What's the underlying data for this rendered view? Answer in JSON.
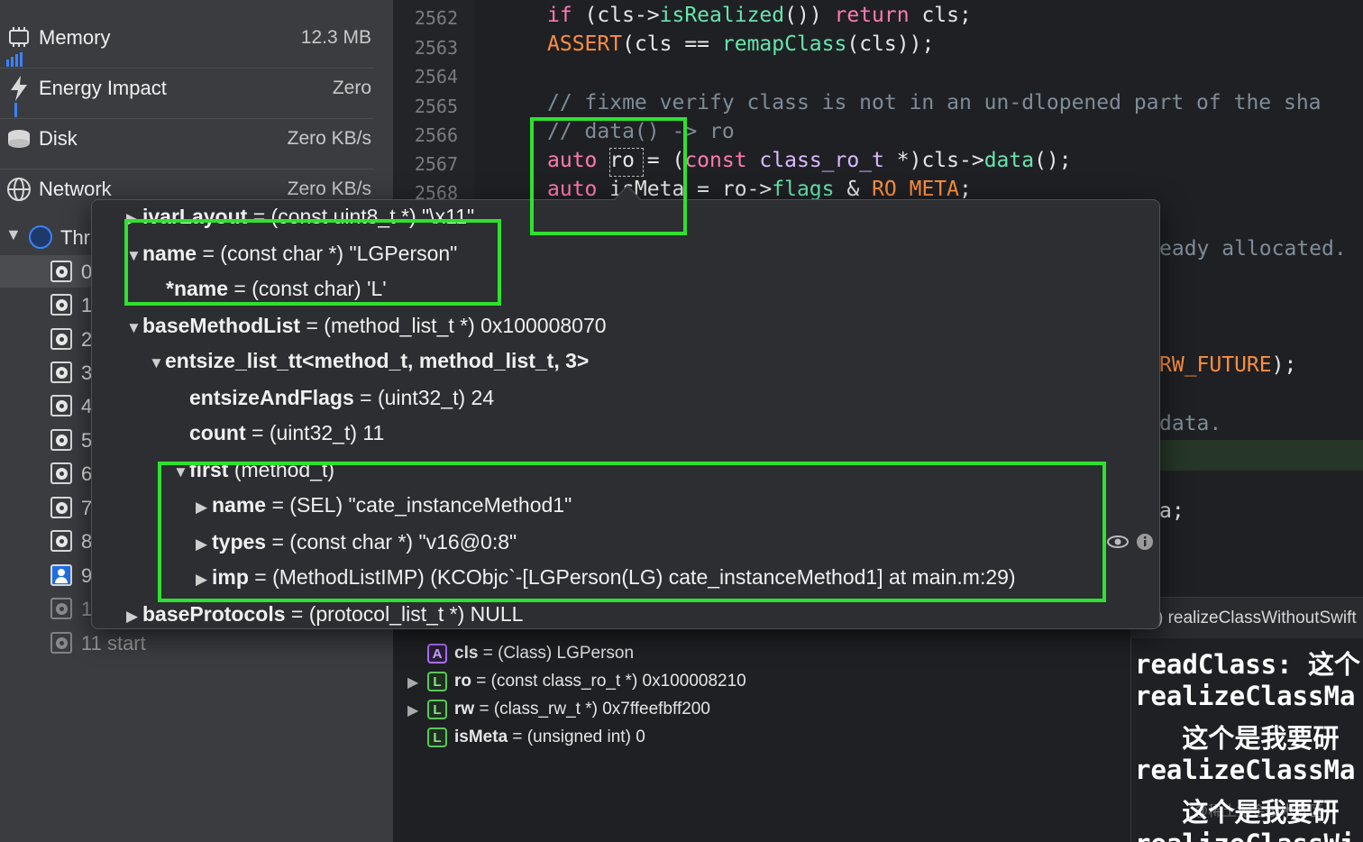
{
  "gauges": [
    {
      "name": "Memory",
      "value": "12.3 MB",
      "icon": "memory-chip-icon"
    },
    {
      "name": "Energy Impact",
      "value": "Zero",
      "icon": "bolt-icon"
    },
    {
      "name": "Disk",
      "value": "Zero KB/s",
      "icon": "disk-icon"
    },
    {
      "name": "Network",
      "value": "Zero KB/s",
      "icon": "globe-icon"
    }
  ],
  "threads": {
    "header": "Thr",
    "items": [
      "0",
      "1",
      "2",
      "3",
      "4",
      "5",
      "6",
      "7",
      "8",
      "9",
      "1"
    ],
    "last": "11 start"
  },
  "editor": {
    "line_numbers": [
      "2562",
      "2563",
      "2564",
      "2565",
      "2566",
      "2567",
      "2568"
    ],
    "fragments": {
      "l1_kw": "if",
      "l1_a": " (cls->",
      "l1_fn": "isRealized",
      "l1_b": "()) ",
      "l1_kw2": "return",
      "l1_c": " cls;",
      "l2_macro": "ASSERT",
      "l2_a": "(cls == ",
      "l2_fn": "remapClass",
      "l2_b": "(cls));",
      "l4_cm": "// fixme verify class is not in an un-dlopened part of the sha",
      "l5_cm": "// data() -> ro",
      "l6_kw": "auto",
      "l6_a": " ro = (",
      "l6_kw2": "const",
      "l6_ty": " class_ro_t",
      "l6_b": " *)cls->",
      "l6_fn": "data",
      "l6_c": "();",
      "l7_kw": "auto",
      "l7_a": " isMeta = ro->",
      "l7_fn": "flags",
      "l7_b": " & ",
      "l7_macro": "RO_META",
      "l7_c": ";"
    },
    "right_fragments": {
      "r1": "eady allocated.",
      "r2_macro": "RW_FUTURE",
      "r2_b": ");",
      "r3": "data.",
      "r4": "a;"
    }
  },
  "popover": {
    "rows": [
      {
        "tri": "▶",
        "name": "ivarLayout",
        "rest": " = (const uint8_t *) \"\\x11\""
      },
      {
        "tri": "▼",
        "name": "name",
        "rest": " = (const char *) \"LGPerson\""
      },
      {
        "tri": "",
        "name": "*name",
        "rest": " = (const char) 'L'"
      },
      {
        "tri": "▼",
        "name": "baseMethodList",
        "rest": " = (method_list_t *) 0x100008070"
      },
      {
        "tri": "▼",
        "name": "entsize_list_tt<method_t, method_list_t, 3>",
        "rest": ""
      },
      {
        "tri": "",
        "name": "entsizeAndFlags",
        "rest": " = (uint32_t) 24"
      },
      {
        "tri": "",
        "name": "count",
        "rest": " = (uint32_t) 11"
      },
      {
        "tri": "▼",
        "name": "first",
        "rest": " (method_t)"
      },
      {
        "tri": "▶",
        "name": "name",
        "rest": " = (SEL) \"cate_instanceMethod1\""
      },
      {
        "tri": "▶",
        "name": "types",
        "rest": " = (const char *) \"v16@0:8\""
      },
      {
        "tri": "▶",
        "name": "imp",
        "rest": " = (MethodListIMP) (KCObjc`-[LGPerson(LG) cate_instanceMethod1] at main.m:29)"
      },
      {
        "tri": "▶",
        "name": "baseProtocols",
        "rest": " = (protocol_list_t *) NULL"
      }
    ]
  },
  "breadcrumb": ") realizeClassWithoutSwift",
  "variables": [
    {
      "tri": "",
      "badge": "A",
      "name": "cls",
      "rest": " = (Class) LGPerson"
    },
    {
      "tri": "▶",
      "badge": "L",
      "name": "ro",
      "rest": " = (const class_ro_t *) 0x100008210"
    },
    {
      "tri": "▶",
      "badge": "L",
      "name": "rw",
      "rest": " = (class_rw_t *) 0x7ffeefbff200"
    },
    {
      "tri": "",
      "badge": "L",
      "name": "isMeta",
      "rest": " = (unsigned int) 0"
    }
  ],
  "console": [
    "readClass: 这个",
    "realizeClassMa",
    "   这个是我要研",
    "realizeClassMa",
    "   这个是我要研",
    "realizeClassWi"
  ],
  "watermark": "@稀土掘金技术社区",
  "colors": {
    "highlight": "#2fe12f",
    "keyword": "#ff7ab2",
    "function": "#67e5ad",
    "macro": "#fd8f3f",
    "comment": "#7f8c98"
  }
}
